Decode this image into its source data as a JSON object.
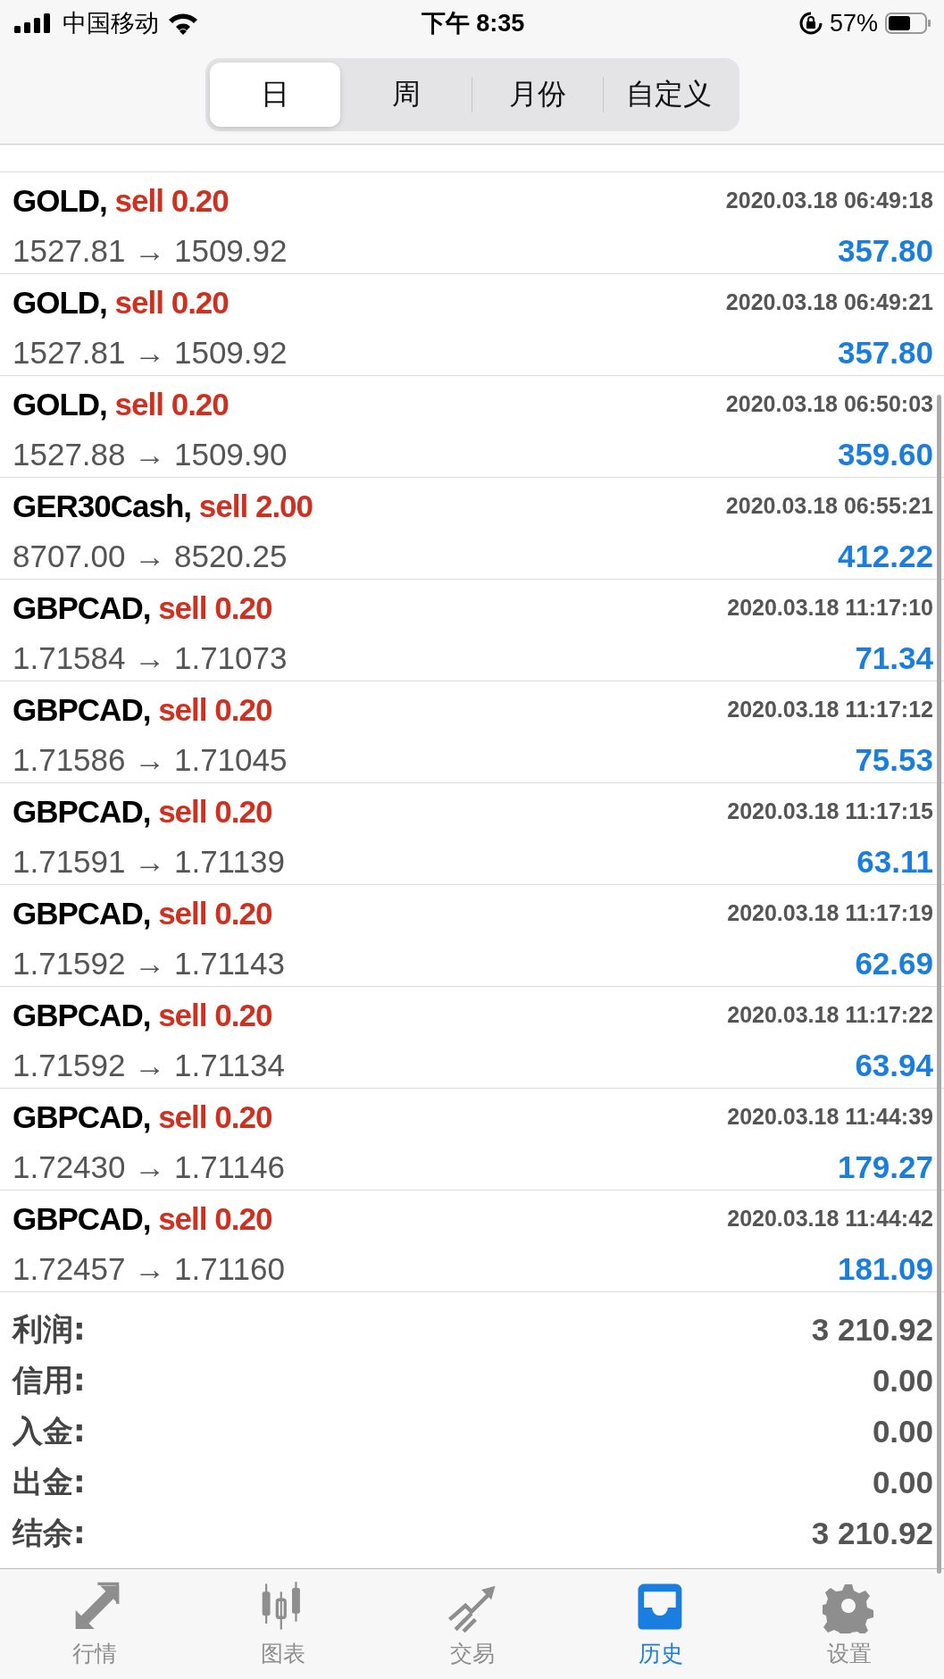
{
  "status_bar": {
    "carrier": "中国移动",
    "time": "下午 8:35",
    "battery": "57%"
  },
  "tabs": [
    {
      "label": "日",
      "selected": true
    },
    {
      "label": "周",
      "selected": false
    },
    {
      "label": "月份",
      "selected": false
    },
    {
      "label": "自定义",
      "selected": false
    }
  ],
  "deals": [
    {
      "symbol": "GOLD,",
      "side": "sell 0.20",
      "time": "2020.03.18 06:49:18",
      "prices": "1527.81 → 1509.92",
      "profit": "357.80"
    },
    {
      "symbol": "GOLD,",
      "side": "sell 0.20",
      "time": "2020.03.18 06:49:21",
      "prices": "1527.81 → 1509.92",
      "profit": "357.80"
    },
    {
      "symbol": "GOLD,",
      "side": "sell 0.20",
      "time": "2020.03.18 06:50:03",
      "prices": "1527.88 → 1509.90",
      "profit": "359.60"
    },
    {
      "symbol": "GER30Cash,",
      "side": "sell 2.00",
      "time": "2020.03.18 06:55:21",
      "prices": "8707.00 → 8520.25",
      "profit": "412.22"
    },
    {
      "symbol": "GBPCAD,",
      "side": "sell 0.20",
      "time": "2020.03.18 11:17:10",
      "prices": "1.71584 → 1.71073",
      "profit": "71.34"
    },
    {
      "symbol": "GBPCAD,",
      "side": "sell 0.20",
      "time": "2020.03.18 11:17:12",
      "prices": "1.71586 → 1.71045",
      "profit": "75.53"
    },
    {
      "symbol": "GBPCAD,",
      "side": "sell 0.20",
      "time": "2020.03.18 11:17:15",
      "prices": "1.71591 → 1.71139",
      "profit": "63.11"
    },
    {
      "symbol": "GBPCAD,",
      "side": "sell 0.20",
      "time": "2020.03.18 11:17:19",
      "prices": "1.71592 → 1.71143",
      "profit": "62.69"
    },
    {
      "symbol": "GBPCAD,",
      "side": "sell 0.20",
      "time": "2020.03.18 11:17:22",
      "prices": "1.71592 → 1.71134",
      "profit": "63.94"
    },
    {
      "symbol": "GBPCAD,",
      "side": "sell 0.20",
      "time": "2020.03.18 11:44:39",
      "prices": "1.72430 → 1.71146",
      "profit": "179.27"
    },
    {
      "symbol": "GBPCAD,",
      "side": "sell 0.20",
      "time": "2020.03.18 11:44:42",
      "prices": "1.72457 → 1.71160",
      "profit": "181.09"
    }
  ],
  "summary": [
    {
      "label": "利润:",
      "value": "3 210.92"
    },
    {
      "label": "信用:",
      "value": "0.00"
    },
    {
      "label": "入金:",
      "value": "0.00"
    },
    {
      "label": "出金:",
      "value": "0.00"
    },
    {
      "label": "结余:",
      "value": "3 210.92"
    }
  ],
  "tab_bar": [
    {
      "kind": "quotes",
      "label": "行情",
      "selected": false
    },
    {
      "kind": "chart",
      "label": "图表",
      "selected": false
    },
    {
      "kind": "trade",
      "label": "交易",
      "selected": false
    },
    {
      "kind": "history",
      "label": "历史",
      "selected": true
    },
    {
      "kind": "settings",
      "label": "设置",
      "selected": false
    }
  ]
}
